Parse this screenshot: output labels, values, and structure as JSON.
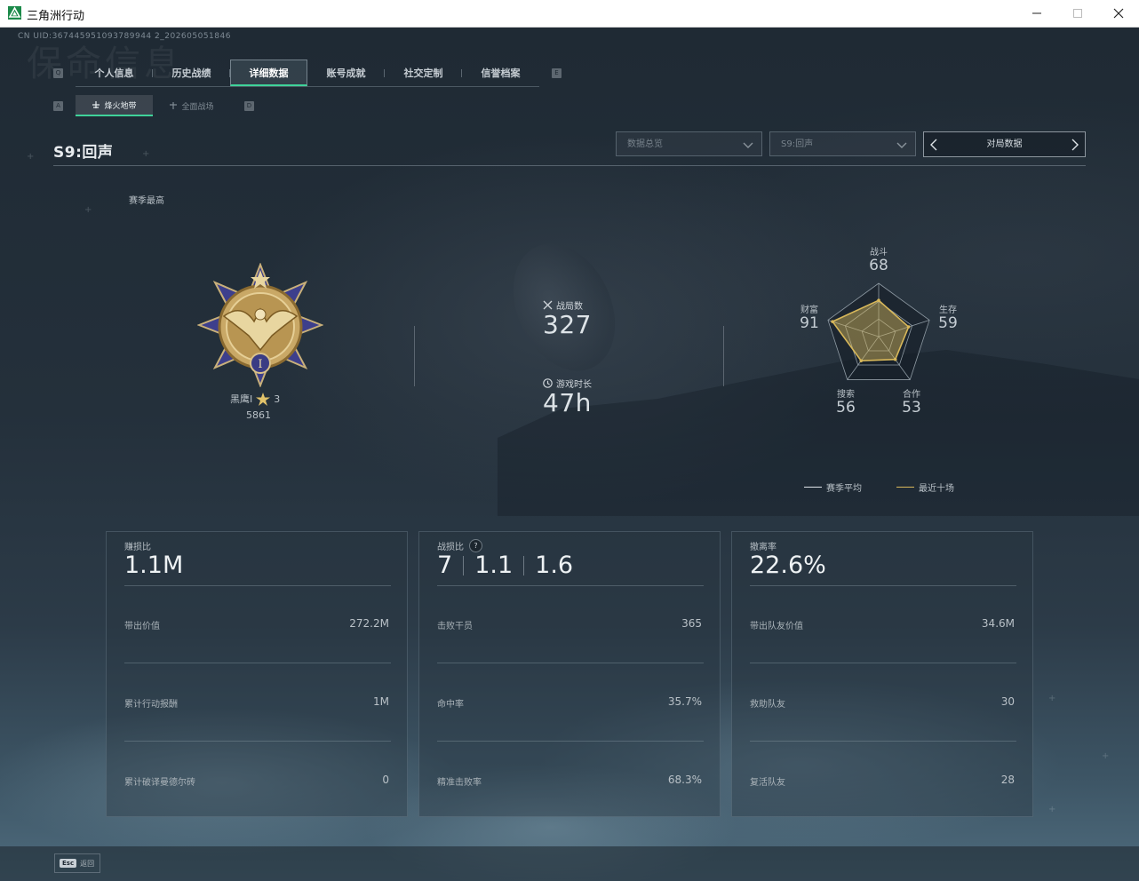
{
  "window": {
    "title": "三角洲行动"
  },
  "uid": "CN UID:367445951093789944 2_202605051846",
  "watermark": "保命信息",
  "tabs": {
    "key_left": "Q",
    "key_right": "E",
    "items": [
      {
        "label": "个人信息"
      },
      {
        "label": "历史战绩"
      },
      {
        "label": "详细数据"
      },
      {
        "label": "账号成就"
      },
      {
        "label": "社交定制"
      },
      {
        "label": "信誉档案"
      }
    ],
    "active_index": 2
  },
  "subtabs": {
    "key_left": "A",
    "key_right": "D",
    "items": [
      {
        "label": "烽火地带"
      },
      {
        "label": "全面战场"
      }
    ]
  },
  "header": {
    "season": "S9:回声",
    "dropdown_summary": "数据总览",
    "dropdown_season": "S9:回声",
    "match_switch": "对局数据"
  },
  "season_best_label": "赛季最高",
  "rank": {
    "name": "黑鹰I",
    "stars": "3",
    "score": "5861"
  },
  "stats": {
    "matches_label": "战局数",
    "matches_value": "327",
    "playtime_label": "游戏时长",
    "playtime_value": "47h"
  },
  "radar": {
    "axes": [
      {
        "label": "战斗",
        "value": "68"
      },
      {
        "label": "生存",
        "value": "59"
      },
      {
        "label": "合作",
        "value": "53"
      },
      {
        "label": "搜索",
        "value": "56"
      },
      {
        "label": "财富",
        "value": "91"
      }
    ],
    "scores": [
      68,
      59,
      53,
      56,
      91
    ],
    "legend_season_avg": "赛季平均",
    "legend_recent": "最近十场",
    "color_avg": "#dfe4e8",
    "color_recent": "#d8b85a"
  },
  "cards": [
    {
      "title": "赚损比",
      "big": "1.1M",
      "rows": [
        {
          "label": "带出价值",
          "value": "272.2M"
        },
        {
          "label": "累计行动报酬",
          "value": "1M"
        },
        {
          "label": "累计破译曼德尔砖",
          "value": "0"
        }
      ]
    },
    {
      "title": "战损比",
      "help": "?",
      "big_parts": [
        "7",
        "1.1",
        "1.6"
      ],
      "rows": [
        {
          "label": "击败干员",
          "value": "365"
        },
        {
          "label": "命中率",
          "value": "35.7%"
        },
        {
          "label": "精准击败率",
          "value": "68.3%"
        }
      ]
    },
    {
      "title": "撤离率",
      "big": "22.6%",
      "rows": [
        {
          "label": "带出队友价值",
          "value": "34.6M"
        },
        {
          "label": "救助队友",
          "value": "30"
        },
        {
          "label": "复活队友",
          "value": "28"
        }
      ]
    }
  ],
  "footer": {
    "esc_key": "Esc",
    "esc_label": "返回"
  },
  "colors": {
    "accent": "#3fd39a",
    "gold": "#d8b85a"
  }
}
